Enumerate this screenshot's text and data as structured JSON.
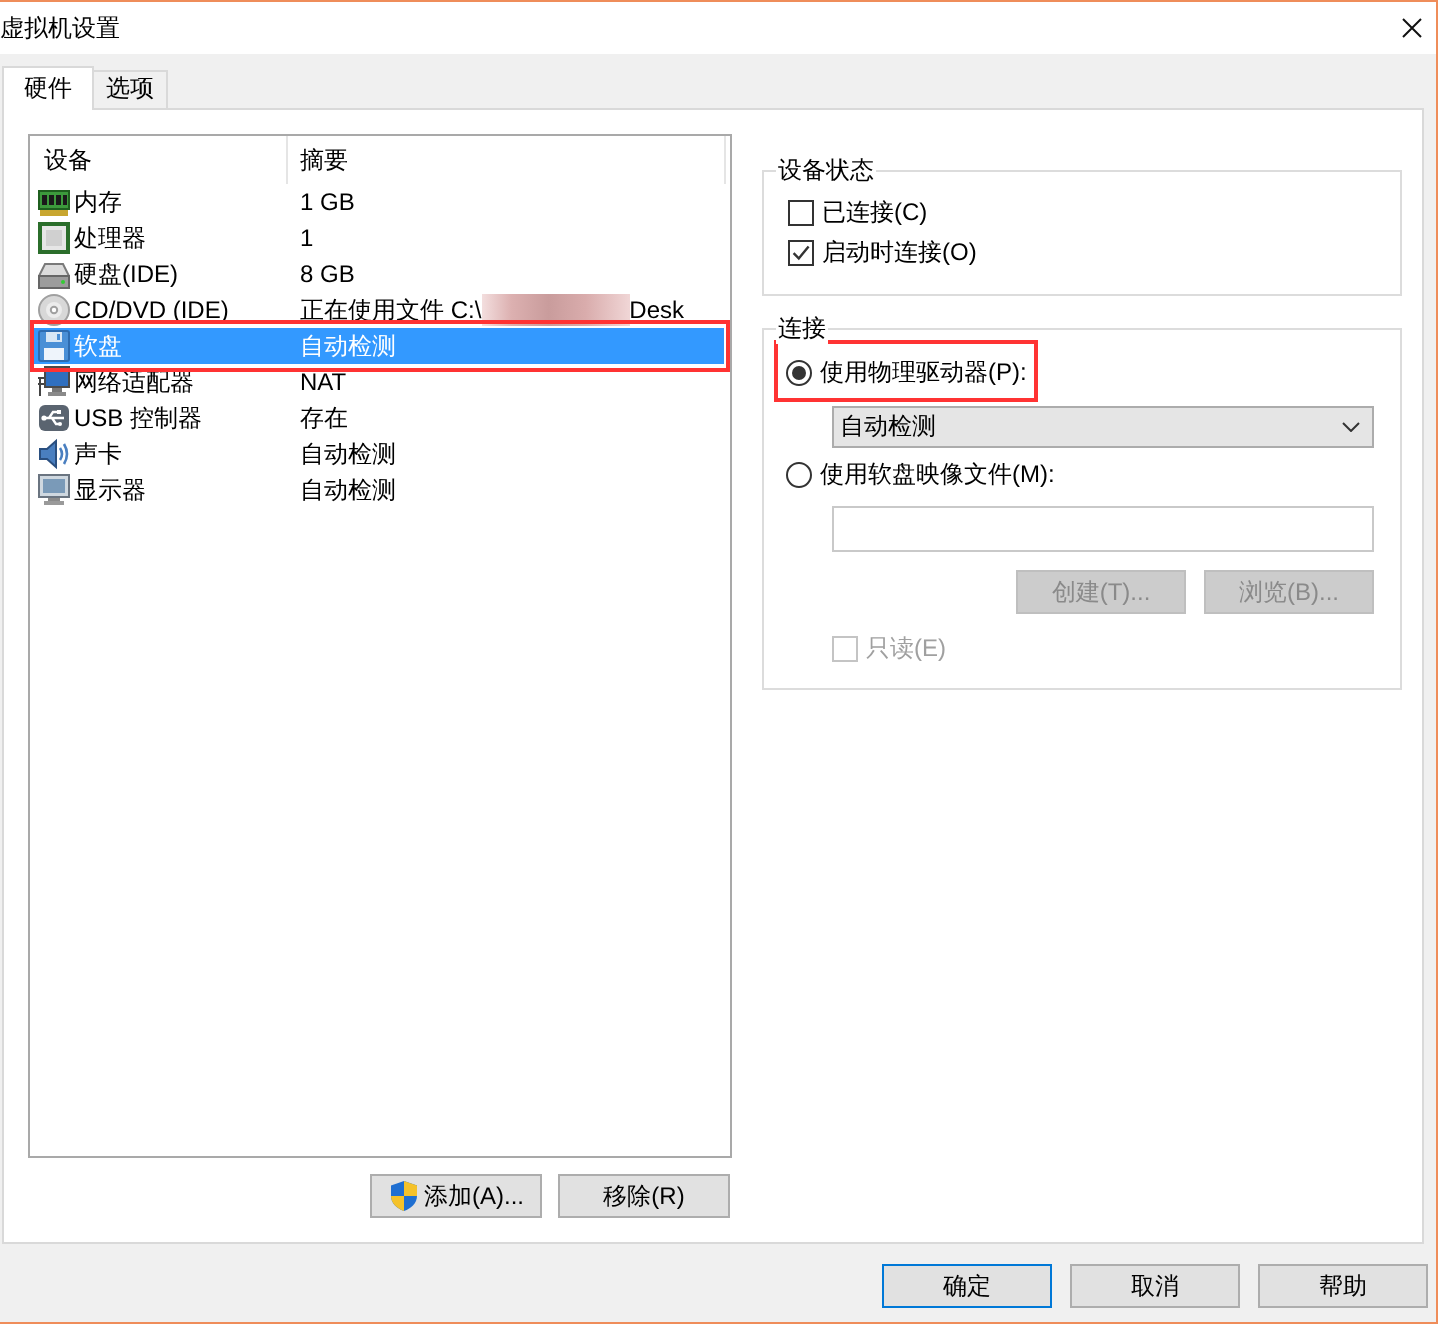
{
  "window": {
    "title": "虚拟机设置"
  },
  "tabs": [
    {
      "label": "硬件",
      "selected": true
    },
    {
      "label": "选项",
      "selected": false
    }
  ],
  "device_list": {
    "columns": [
      "设备",
      "摘要"
    ],
    "rows": [
      {
        "kind": "memory",
        "device": "内存",
        "summary": "1 GB",
        "selected": false
      },
      {
        "kind": "processor",
        "device": "处理器",
        "summary": "1",
        "selected": false
      },
      {
        "kind": "hard_disk",
        "device": "硬盘(IDE)",
        "summary": "8 GB",
        "selected": false
      },
      {
        "kind": "cd_dvd",
        "device": "CD/DVD (IDE)",
        "summary": "正在使用文件 C:\\",
        "redacted": true,
        "summary_after_redaction": "Desk",
        "selected": false
      },
      {
        "kind": "floppy",
        "device": "软盘",
        "summary": "自动检测",
        "selected": true,
        "highlighted": true
      },
      {
        "kind": "network",
        "device": "网络适配器",
        "summary": "NAT",
        "selected": false
      },
      {
        "kind": "usb",
        "device": "USB 控制器",
        "summary": "存在",
        "selected": false
      },
      {
        "kind": "sound",
        "device": "声卡",
        "summary": "自动检测",
        "selected": false
      },
      {
        "kind": "display",
        "device": "显示器",
        "summary": "自动检测",
        "selected": false
      }
    ]
  },
  "list_buttons": [
    {
      "label": "添加(A)...",
      "shield": true
    },
    {
      "label": "移除(R)",
      "shield": false
    }
  ],
  "device_status": {
    "title": "设备状态",
    "options": [
      {
        "label": "已连接(C)",
        "checked": false
      },
      {
        "label": "启动时连接(O)",
        "checked": true
      }
    ]
  },
  "connection": {
    "title": "连接",
    "sources": [
      {
        "kind": "physical_drive",
        "label": "使用物理驱动器(P):",
        "selected": true,
        "highlighted": true,
        "dropdown": {
          "value": "自动检测"
        }
      },
      {
        "kind": "image_file",
        "label": "使用软盘映像文件(M):",
        "selected": false,
        "buttons": [
          {
            "label": "创建(T)...",
            "disabled": true
          },
          {
            "label": "浏览(B)...",
            "disabled": true
          }
        ],
        "read_only": {
          "label": "只读(E)",
          "checked": false,
          "disabled": true
        }
      }
    ]
  },
  "dialog_buttons": [
    {
      "label": "确定",
      "default": true
    },
    {
      "label": "取消",
      "default": false
    },
    {
      "label": "帮助",
      "default": false
    }
  ]
}
